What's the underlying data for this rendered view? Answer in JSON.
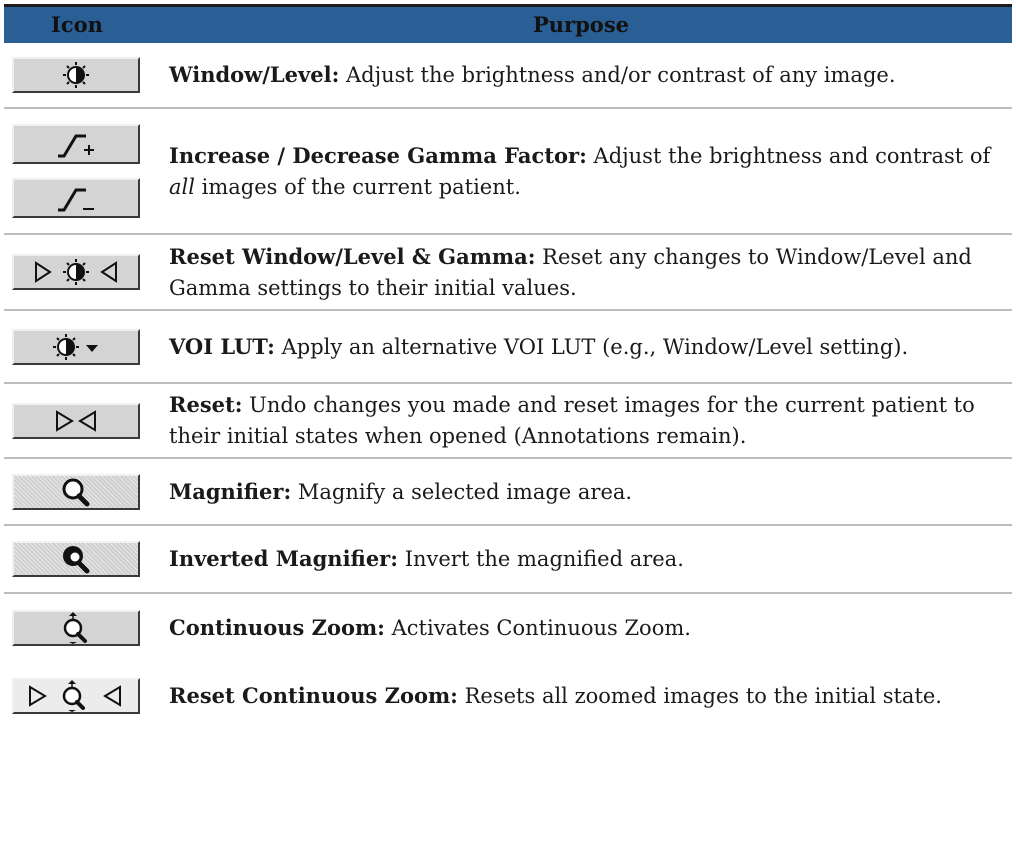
{
  "header": {
    "icon_col": "Icon",
    "purpose_col": "Purpose"
  },
  "rows": [
    {
      "icons": [
        "window-level-icon"
      ],
      "term": "Window/Level:",
      "pre": " Adjust the brightness and/or contrast of any image.",
      "em": "",
      "post": ""
    },
    {
      "icons": [
        "gamma-increase-icon",
        "gamma-decrease-icon"
      ],
      "term": "Increase / Decrease Gamma Factor:",
      "pre": " Adjust the brightness and contrast of ",
      "em": "all",
      "post": " images of the current patient."
    },
    {
      "icons": [
        "reset-window-level-gamma-icon"
      ],
      "term": "Reset Window/Level & Gamma:",
      "pre": " Reset any changes to Window/Level and Gamma settings to their initial values.",
      "em": "",
      "post": ""
    },
    {
      "icons": [
        "voi-lut-icon"
      ],
      "term": "VOI LUT:",
      "pre": " Apply an alternative VOI LUT (e.g., Window/Level setting).",
      "em": "",
      "post": ""
    },
    {
      "icons": [
        "reset-icon"
      ],
      "term": "Reset:",
      "pre": " Undo changes you made and reset images for the current patient to their initial states when opened (Annotations remain).",
      "em": "",
      "post": ""
    },
    {
      "icons": [
        "magnifier-icon"
      ],
      "term": "Magnifier:",
      "pre": " Magnify a selected image area.",
      "em": "",
      "post": ""
    },
    {
      "icons": [
        "inverted-magnifier-icon"
      ],
      "term": "Inverted Magnifier:",
      "pre": " Invert the magnified area.",
      "em": "",
      "post": ""
    },
    {
      "icons": [
        "continuous-zoom-icon"
      ],
      "term": "Continuous Zoom:",
      "pre": " Activates Continuous Zoom.",
      "em": "",
      "post": ""
    },
    {
      "icons": [
        "reset-continuous-zoom-icon"
      ],
      "term": "Reset Continuous Zoom:",
      "pre": " Resets all zoomed images to the initial state.",
      "em": "",
      "post": ""
    }
  ]
}
